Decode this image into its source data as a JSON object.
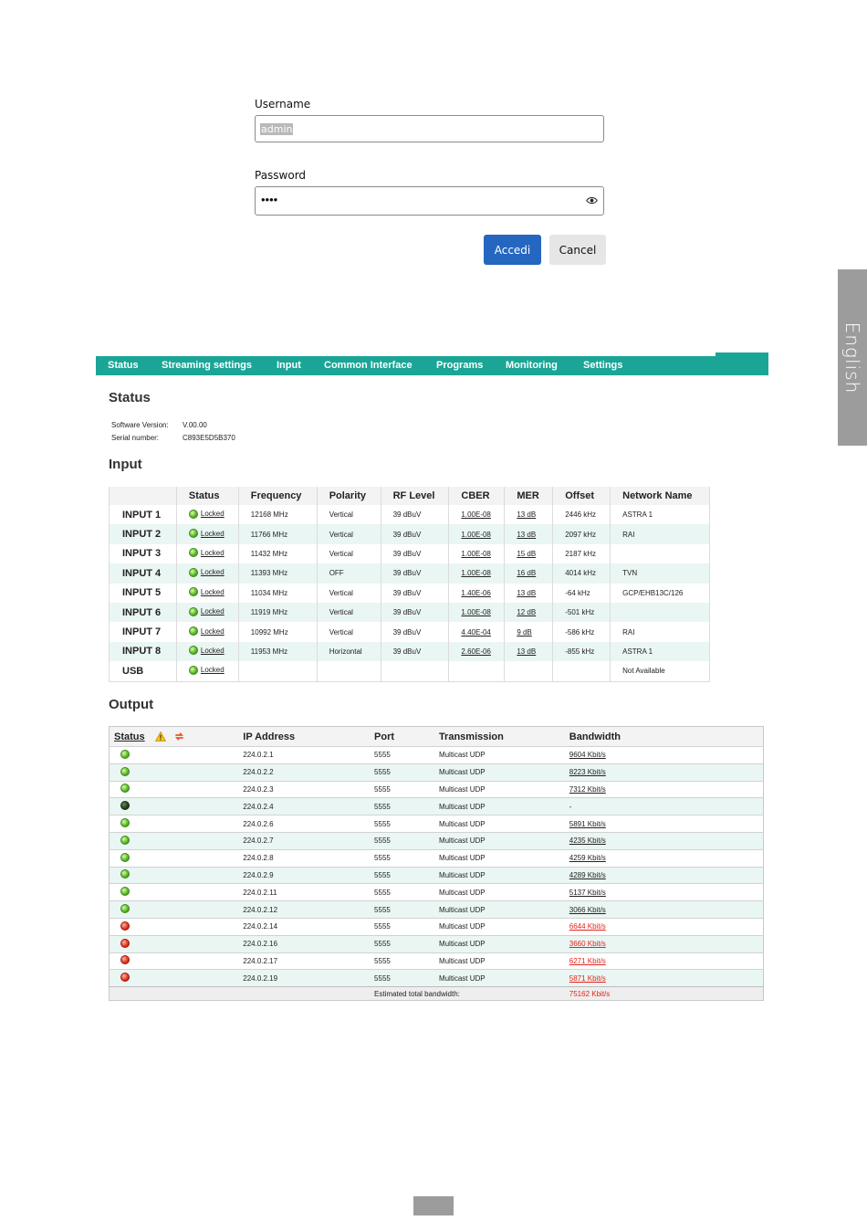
{
  "login": {
    "username_label": "Username",
    "username_value": "admin",
    "password_label": "Password",
    "password_value": "••••",
    "submit_label": "Accedi",
    "cancel_label": "Cancel"
  },
  "side_tab": "English",
  "nav": [
    "Status",
    "Streaming settings",
    "Input",
    "Common Interface",
    "Programs",
    "Monitoring",
    "Settings"
  ],
  "status": {
    "title": "Status",
    "software_label": "Software Version:",
    "software_value": "V.00.00",
    "serial_label": "Serial number:",
    "serial_value": "C893E5D5B370"
  },
  "input": {
    "title": "Input",
    "columns": [
      "",
      "Status",
      "Frequency",
      "Polarity",
      "RF Level",
      "CBER",
      "MER",
      "Offset",
      "Network Name"
    ],
    "rows": [
      {
        "name": "INPUT 1",
        "status": "Locked",
        "freq": "12168 MHz",
        "pol": "Vertical",
        "rf": "39 dBuV",
        "cber": "1.00E-08",
        "mer": "13 dB",
        "offset": "2446 kHz",
        "network": "ASTRA 1"
      },
      {
        "name": "INPUT 2",
        "status": "Locked",
        "freq": "11766 MHz",
        "pol": "Vertical",
        "rf": "39 dBuV",
        "cber": "1.00E-08",
        "mer": "13 dB",
        "offset": "2097 kHz",
        "network": "RAI"
      },
      {
        "name": "INPUT 3",
        "status": "Locked",
        "freq": "11432 MHz",
        "pol": "Vertical",
        "rf": "39 dBuV",
        "cber": "1.00E-08",
        "mer": "15 dB",
        "offset": "2187 kHz",
        "network": ""
      },
      {
        "name": "INPUT 4",
        "status": "Locked",
        "freq": "11393 MHz",
        "pol": "OFF",
        "rf": "39 dBuV",
        "cber": "1.00E-08",
        "mer": "16 dB",
        "offset": "4014 kHz",
        "network": "TVN"
      },
      {
        "name": "INPUT 5",
        "status": "Locked",
        "freq": "11034 MHz",
        "pol": "Vertical",
        "rf": "39 dBuV",
        "cber": "1.40E-06",
        "mer": "13 dB",
        "offset": "-64 kHz",
        "network": "GCP/EHB13C/126"
      },
      {
        "name": "INPUT 6",
        "status": "Locked",
        "freq": "11919 MHz",
        "pol": "Vertical",
        "rf": "39 dBuV",
        "cber": "1.00E-08",
        "mer": "12 dB",
        "offset": "-501 kHz",
        "network": ""
      },
      {
        "name": "INPUT 7",
        "status": "Locked",
        "freq": "10992 MHz",
        "pol": "Vertical",
        "rf": "39 dBuV",
        "cber": "4.40E-04",
        "mer": "9 dB",
        "offset": "-586 kHz",
        "network": "RAI"
      },
      {
        "name": "INPUT 8",
        "status": "Locked",
        "freq": "11953 MHz",
        "pol": "Horizontal",
        "rf": "39 dBuV",
        "cber": "2.60E-06",
        "mer": "13 dB",
        "offset": "-855 kHz",
        "network": "ASTRA 1"
      },
      {
        "name": "USB",
        "status": "Locked",
        "freq": "",
        "pol": "",
        "rf": "",
        "cber": "",
        "mer": "",
        "offset": "",
        "network": "Not Available"
      }
    ]
  },
  "output": {
    "title": "Output",
    "columns": [
      "Status",
      "IP Address",
      "Port",
      "Transmission",
      "Bandwidth"
    ],
    "rows": [
      {
        "led": "green",
        "ip": "224.0.2.1",
        "port": "5555",
        "trans": "Multicast UDP",
        "bw": "9604 Kbit/s"
      },
      {
        "led": "green",
        "ip": "224.0.2.2",
        "port": "5555",
        "trans": "Multicast UDP",
        "bw": "8223 Kbit/s"
      },
      {
        "led": "green",
        "ip": "224.0.2.3",
        "port": "5555",
        "trans": "Multicast UDP",
        "bw": "7312 Kbit/s"
      },
      {
        "led": "dark",
        "ip": "224.0.2.4",
        "port": "5555",
        "trans": "Multicast UDP",
        "bw": "-"
      },
      {
        "led": "green",
        "ip": "224.0.2.6",
        "port": "5555",
        "trans": "Multicast UDP",
        "bw": "5891 Kbit/s"
      },
      {
        "led": "green",
        "ip": "224.0.2.7",
        "port": "5555",
        "trans": "Multicast UDP",
        "bw": "4235 Kbit/s"
      },
      {
        "led": "green",
        "ip": "224.0.2.8",
        "port": "5555",
        "trans": "Multicast UDP",
        "bw": "4259 Kbit/s"
      },
      {
        "led": "green",
        "ip": "224.0.2.9",
        "port": "5555",
        "trans": "Multicast UDP",
        "bw": "4289 Kbit/s"
      },
      {
        "led": "green",
        "ip": "224.0.2.11",
        "port": "5555",
        "trans": "Multicast UDP",
        "bw": "5137 Kbit/s"
      },
      {
        "led": "green",
        "ip": "224.0.2.12",
        "port": "5555",
        "trans": "Multicast UDP",
        "bw": "3066 Kbit/s"
      },
      {
        "led": "red",
        "ip": "224.0.2.14",
        "port": "5555",
        "trans": "Multicast UDP",
        "bw": "6644 Kbit/s"
      },
      {
        "led": "red",
        "ip": "224.0.2.16",
        "port": "5555",
        "trans": "Multicast UDP",
        "bw": "3660 Kbit/s"
      },
      {
        "led": "red",
        "ip": "224.0.2.17",
        "port": "5555",
        "trans": "Multicast UDP",
        "bw": "6271 Kbit/s"
      },
      {
        "led": "red",
        "ip": "224.0.2.19",
        "port": "5555",
        "trans": "Multicast UDP",
        "bw": "5871 Kbit/s"
      }
    ],
    "total_label": "Estimated total bandwidth:",
    "total_value": "75162 Kbit/s"
  },
  "colors": {
    "nav_bg": "#1aa597",
    "primary_button": "#2566c0",
    "row_alt": "#eaf6f3",
    "alert_red": "#e2231a",
    "side_tab": "#9c9c9c"
  },
  "icons": [
    "eye-icon",
    "warning-icon",
    "refresh-icon",
    "status-led"
  ]
}
